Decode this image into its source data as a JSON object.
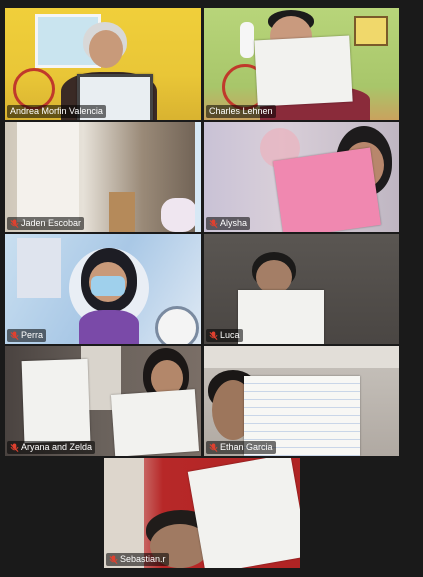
{
  "participants": [
    {
      "name": "Andrea Morfin Valencia",
      "muted": false,
      "active": true
    },
    {
      "name": "Charles Lehnen",
      "muted": false,
      "active": false
    },
    {
      "name": "Jaden Escobar",
      "muted": true,
      "active": false
    },
    {
      "name": "Alysha",
      "muted": true,
      "active": false
    },
    {
      "name": "Perra",
      "muted": true,
      "active": false
    },
    {
      "name": "Luca",
      "muted": true,
      "active": false
    },
    {
      "name": "Aryana and Zelda",
      "muted": true,
      "active": false
    },
    {
      "name": "Ethan Garcia",
      "muted": true,
      "active": false
    },
    {
      "name": "Sebastian.r",
      "muted": true,
      "active": false
    }
  ],
  "colors": {
    "background": "#1a1a1a",
    "active_speaker_border": "#d8d63c",
    "muted_icon": "#e0412f"
  }
}
